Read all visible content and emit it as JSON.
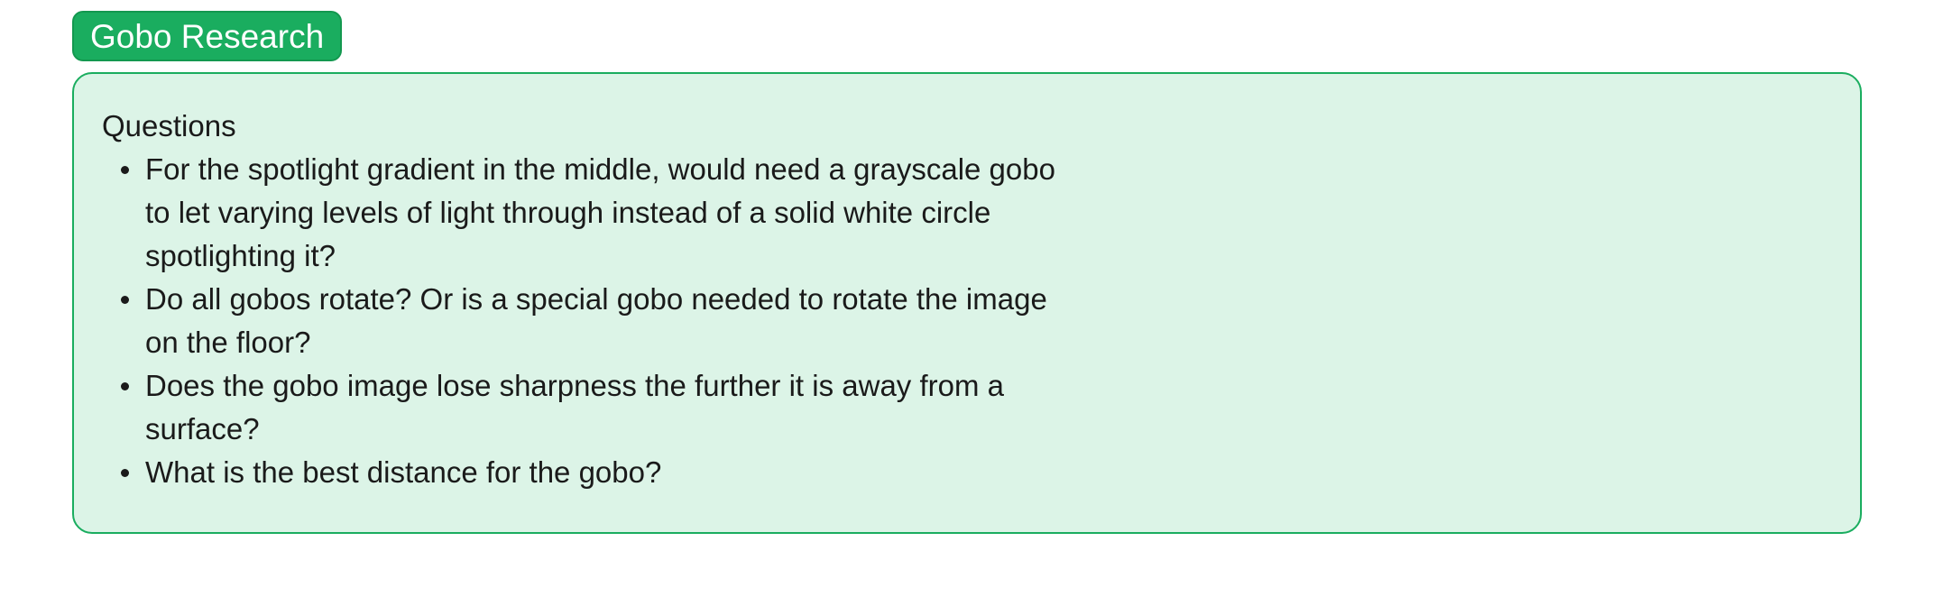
{
  "tag": {
    "label": "Gobo Research"
  },
  "card": {
    "heading": "Questions",
    "items": [
      "For the spotlight gradient in the middle, would need a grayscale gobo to let varying levels of light through instead of a solid white circle spotlighting it?",
      "Do all gobos rotate? Or is a special gobo needed to rotate the image on the floor?",
      "Does the gobo image lose sharpness the further it is away from a surface?",
      "What is the best distance for the gobo?"
    ]
  },
  "colors": {
    "tag_background": "#1aad5f",
    "card_background": "#dcf4e7",
    "card_border": "#1aad5f",
    "text": "#1a1a1a"
  }
}
